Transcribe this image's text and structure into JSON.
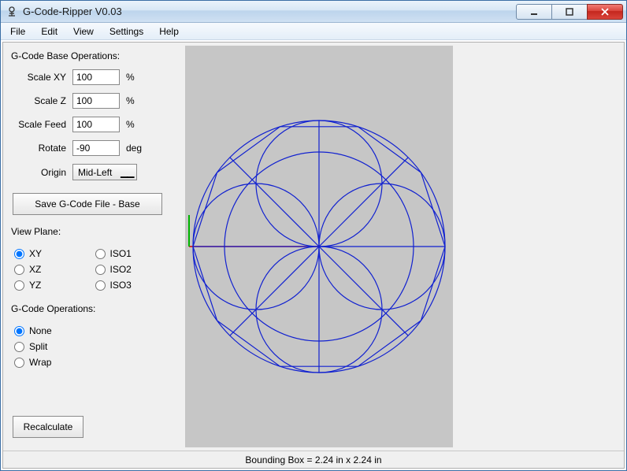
{
  "window": {
    "title": "G-Code-Ripper V0.03"
  },
  "menu": {
    "items": [
      "File",
      "Edit",
      "View",
      "Settings",
      "Help"
    ]
  },
  "base_ops": {
    "title": "G-Code Base Operations:",
    "scale_xy": {
      "label": "Scale XY",
      "value": "100",
      "unit": "%"
    },
    "scale_z": {
      "label": "Scale Z",
      "value": "100",
      "unit": "%"
    },
    "scale_feed": {
      "label": "Scale Feed",
      "value": "100",
      "unit": "%"
    },
    "rotate": {
      "label": "Rotate",
      "value": "-90",
      "unit": "deg"
    },
    "origin": {
      "label": "Origin",
      "value": "Mid-Left"
    }
  },
  "buttons": {
    "save_base": "Save G-Code File - Base",
    "recalculate": "Recalculate"
  },
  "view_plane": {
    "title": "View Plane:",
    "options": {
      "xy": "XY",
      "xz": "XZ",
      "yz": "YZ",
      "iso1": "ISO1",
      "iso2": "ISO2",
      "iso3": "ISO3"
    },
    "selected": "xy"
  },
  "gcode_ops": {
    "title": "G-Code Operations:",
    "options": {
      "none": "None",
      "split": "Split",
      "wrap": "Wrap"
    },
    "selected": "none"
  },
  "status": {
    "text": "Bounding Box = 2.24 in  x 2.24 in"
  },
  "preview": {
    "axis_colors": {
      "x": "#d40000",
      "y": "#00b400"
    },
    "path_color": "#1020d0"
  }
}
